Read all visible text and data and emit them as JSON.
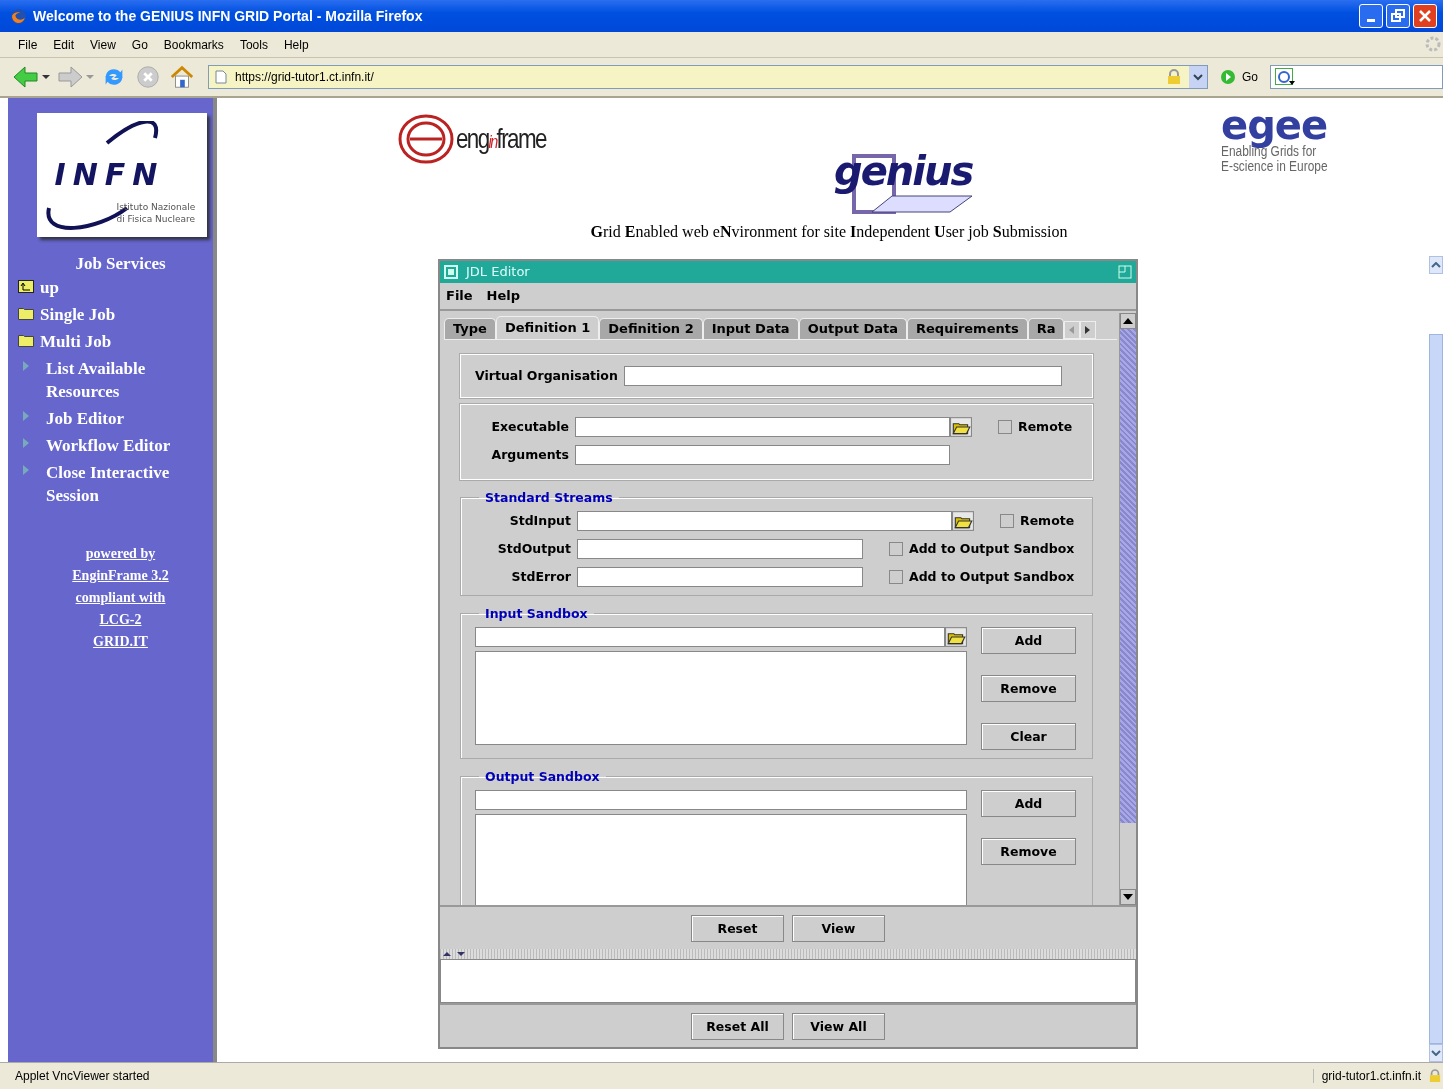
{
  "browser": {
    "title": "Welcome to the GENIUS INFN GRID Portal - Mozilla Firefox",
    "menu": [
      "File",
      "Edit",
      "View",
      "Go",
      "Bookmarks",
      "Tools",
      "Help"
    ],
    "url": "https://grid-tutor1.ct.infn.it/",
    "go_label": "Go"
  },
  "sidebar": {
    "logo": {
      "name": "INFN",
      "subtitle": [
        "Istituto Nazionale",
        "di Fisica Nucleare"
      ]
    },
    "heading": "Job Services",
    "items": [
      {
        "label": "up",
        "kind": "up"
      },
      {
        "label": "Single Job",
        "kind": "folder"
      },
      {
        "label": "Multi Job",
        "kind": "folder"
      },
      {
        "label": "List Available Resources",
        "kind": "link"
      },
      {
        "label": "Job Editor",
        "kind": "link"
      },
      {
        "label": "Workflow Editor",
        "kind": "link"
      },
      {
        "label": "Close Interactive Session",
        "kind": "link"
      }
    ],
    "links": [
      "powered by",
      "EnginFrame 3.2",
      "compliant with",
      "LCG-2",
      "GRID.IT"
    ]
  },
  "header": {
    "enginframe": [
      "eng",
      "in",
      "frame"
    ],
    "genius": "genius",
    "egee": {
      "name": "egee",
      "tagline": [
        "Enabling Grids for",
        "E-science in Europe"
      ]
    },
    "subtitle": "**G**rid **E**nabled web e**N**vironment for site **I**ndependent **U**ser job **S**ubmission"
  },
  "applet": {
    "title": "JDL Editor",
    "menu": [
      "File",
      "Help"
    ],
    "tabs": [
      {
        "label": "Type",
        "selected": false
      },
      {
        "label": "Definition 1",
        "selected": true
      },
      {
        "label": "Definition 2",
        "selected": false
      },
      {
        "label": "Input Data",
        "selected": false
      },
      {
        "label": "Output Data",
        "selected": false
      },
      {
        "label": "Requirements",
        "selected": false
      },
      {
        "label": "Ra",
        "selected": false
      }
    ],
    "vo": {
      "label": "Virtual Organisation"
    },
    "executable": {
      "label": "Executable",
      "option": "Remote",
      "checked": false
    },
    "arguments": {
      "label": "Arguments"
    },
    "streams": {
      "title": "Standard Streams",
      "rows": [
        {
          "label": "StdInput",
          "kind": "browse",
          "option": "Remote",
          "checked": false
        },
        {
          "label": "StdOutput",
          "kind": "plain",
          "option": "Add to Output Sandbox",
          "checked": false
        },
        {
          "label": "StdError",
          "kind": "plain",
          "option": "Add to Output Sandbox",
          "checked": false
        }
      ]
    },
    "input_sandbox": {
      "title": "Input Sandbox",
      "buttons": [
        "Add",
        "Remove",
        "Clear"
      ]
    },
    "output_sandbox": {
      "title": "Output Sandbox",
      "buttons": [
        "Add",
        "Remove"
      ]
    },
    "buttons": [
      "Reset",
      "View"
    ],
    "global_buttons": [
      "Reset All",
      "View All"
    ]
  },
  "status_bar": {
    "text": "Applet VncViewer started",
    "host": "grid-tutor1.ct.infn.it"
  }
}
